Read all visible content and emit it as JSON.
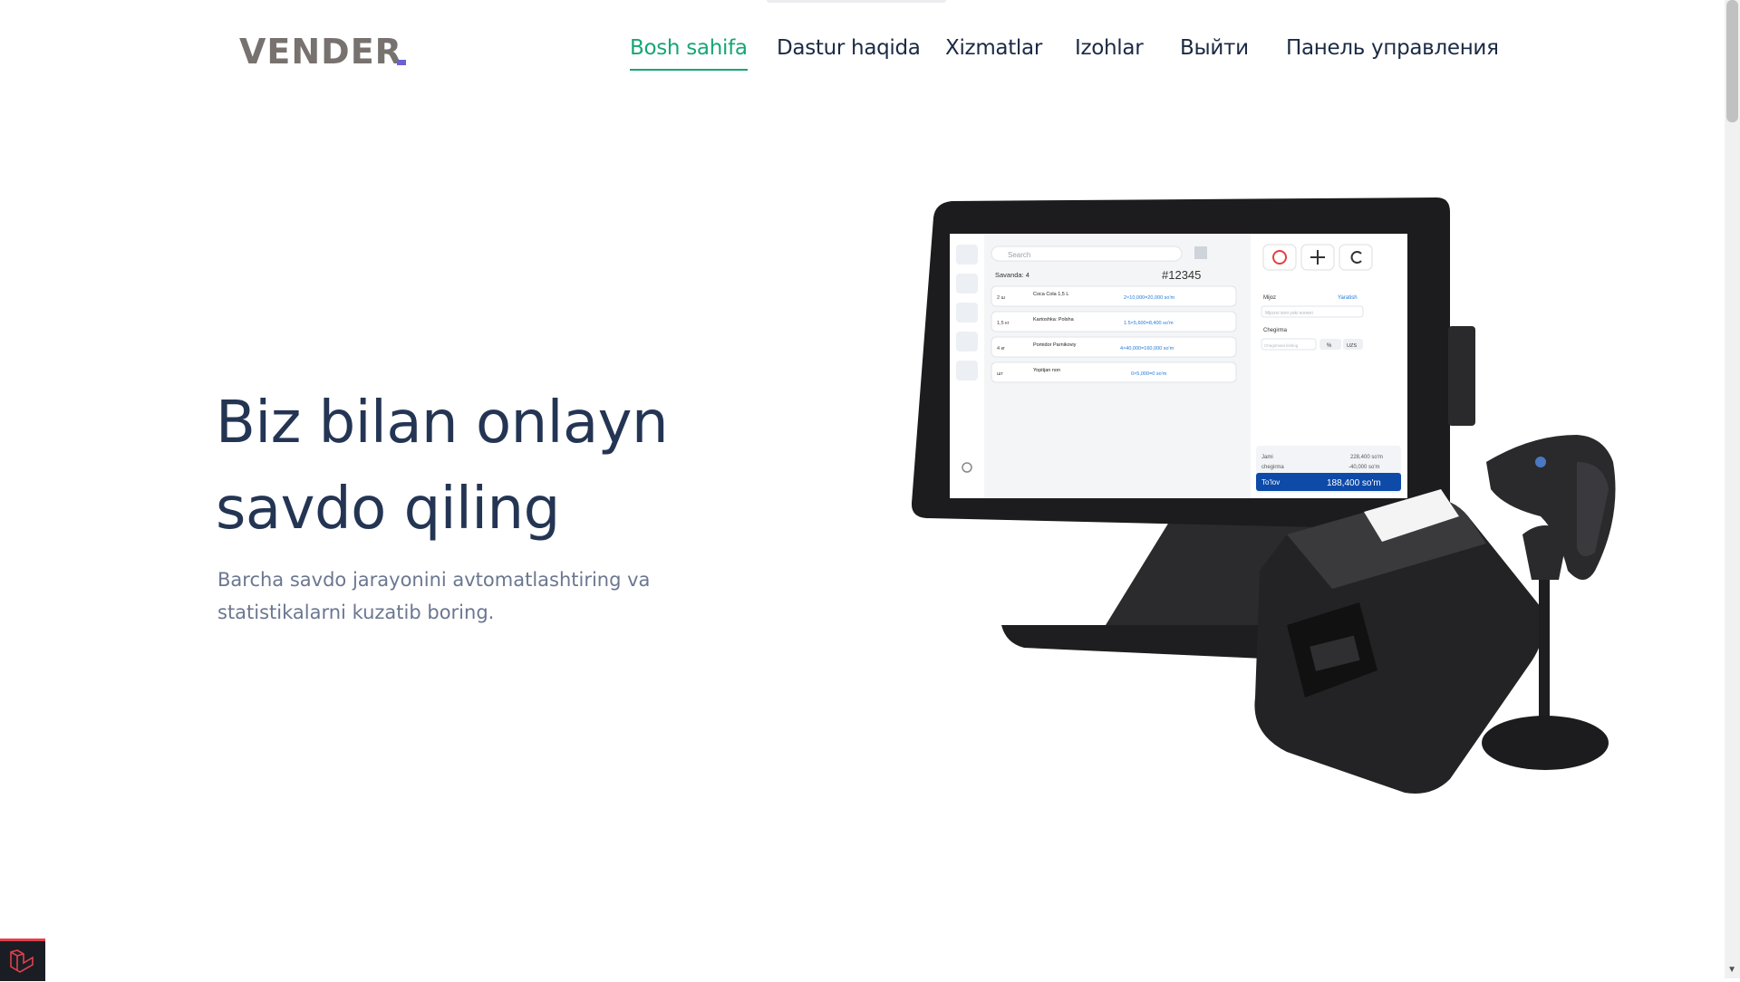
{
  "brand": {
    "logo_text": "VENDER",
    "accent": "#17a673",
    "text_dark": "#243554",
    "logo_highlight": "#6b5fd6"
  },
  "nav": {
    "items": [
      {
        "label": "Bosh sahifa",
        "active": true
      },
      {
        "label": "Dastur haqida",
        "active": false
      },
      {
        "label": "Xizmatlar",
        "active": false
      },
      {
        "label": "Izohlar",
        "active": false
      },
      {
        "label": "Выйти",
        "active": false
      },
      {
        "label": "Панель управления",
        "active": false
      }
    ]
  },
  "hero": {
    "title_line1": "Biz bilan onlayn",
    "title_line2": "savdo qiling",
    "subtitle": "Barcha savdo jarayonini avtomatlashtiring va statistikalarni kuzatib boring."
  },
  "pos_screen": {
    "search_placeholder": "Search",
    "cart_count": "Savanda: 4",
    "order_number": "#12345",
    "items": [
      {
        "name": "Coca Cola 1,5 L",
        "qty": "2 ш",
        "price": "2×10,000=20,000 so'm"
      },
      {
        "name": "Kartoshka: Polsha",
        "qty": "1,5 кг",
        "price": "1.5×5,600=8,400 so'm"
      },
      {
        "name": "Pomidor Parnikoviy",
        "qty": "4 кг",
        "price": "4×40,000=160,000 so'm"
      },
      {
        "name": "Yopitjan non",
        "qty": "шт",
        "price": "0×5,000=0 so'm"
      }
    ],
    "client_label": "Mijoz",
    "create_label": "Yaratish",
    "client_placeholder": "Mijozni ismi yoki nomeri",
    "discount_label": "Chegirma",
    "discount_placeholder": "Chegirmani kiriting",
    "percent": "%",
    "currency": "UZS",
    "total_label": "Jami",
    "total_value": "228,400 so'm",
    "discount_row_label": "chegirma",
    "discount_value": "-40,000 so'm",
    "pay_label": "To'lov",
    "pay_value": "188,400 so'm"
  }
}
